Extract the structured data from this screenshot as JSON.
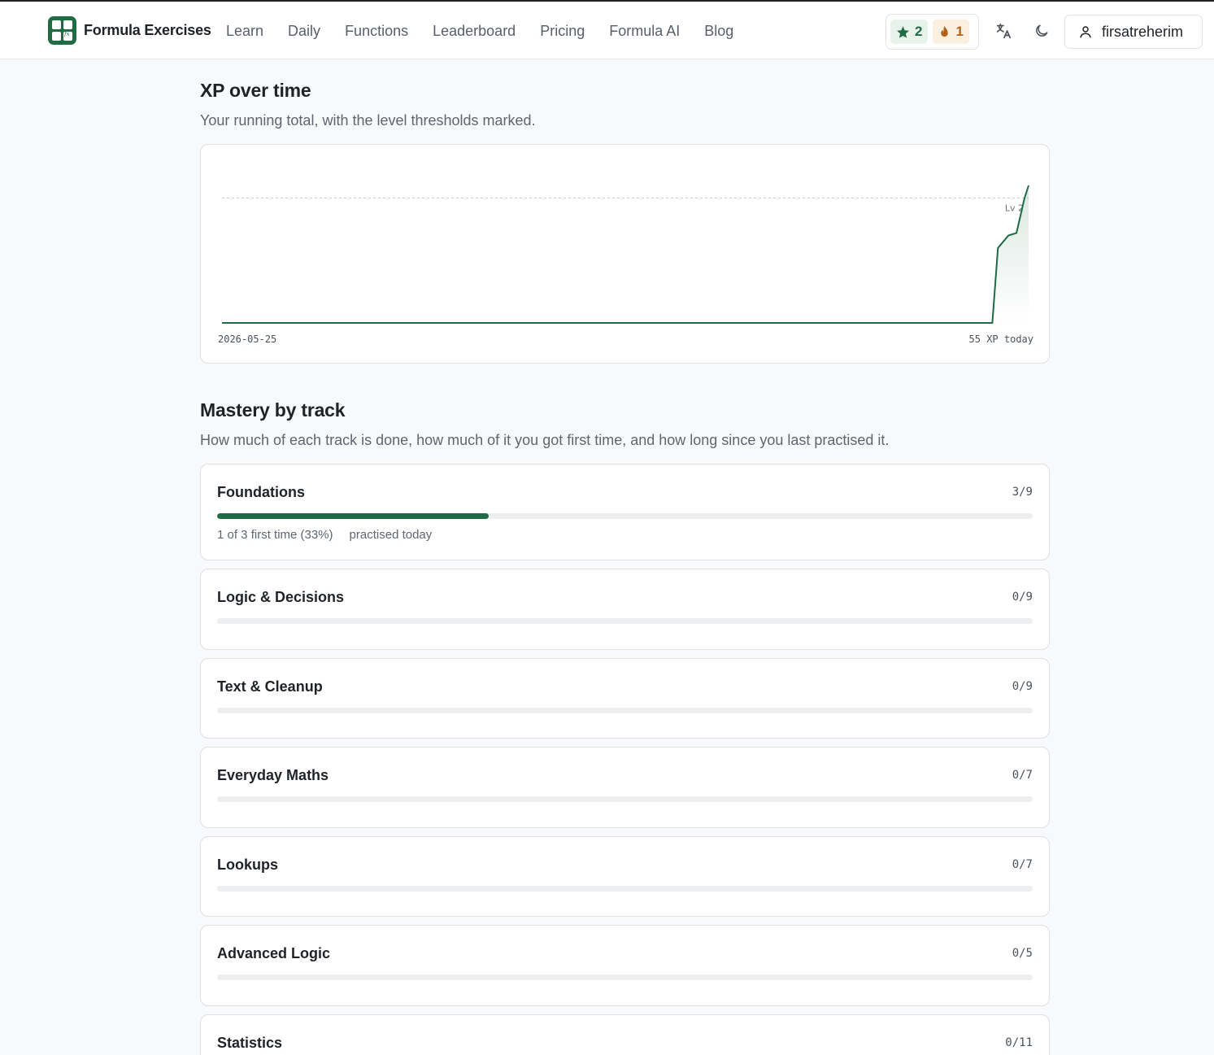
{
  "header": {
    "brand": "Formula Exercises",
    "nav": [
      "Learn",
      "Daily",
      "Functions",
      "Leaderboard",
      "Pricing",
      "Formula AI",
      "Blog"
    ],
    "xp_count": "2",
    "streak_count": "1",
    "username": "firsatreherim"
  },
  "xp_section": {
    "title": "XP over time",
    "subtitle": "Your running total, with the level thresholds marked."
  },
  "chart_data": {
    "type": "area",
    "series": [
      {
        "x": [
          0,
          0.955,
          0.962,
          0.975,
          0.985,
          0.995,
          1.0
        ],
        "values": [
          0,
          0,
          30,
          35,
          36,
          50,
          55
        ]
      }
    ],
    "x_start_label": "2026-05-25",
    "x_end_label": "55 XP today",
    "thresholds": [
      {
        "label": "Lv 2",
        "value": 50
      }
    ],
    "ylim": [
      0,
      55
    ],
    "line_color": "#1f6b43",
    "grid": false
  },
  "mastery_section": {
    "title": "Mastery by track",
    "subtitle": "How much of each track is done, how much of it you got first time, and how long since you last practised it."
  },
  "tracks": [
    {
      "name": "Foundations",
      "count": "3/9",
      "progress": 0.333,
      "first_time": "1 of 3 first time (33%)",
      "last_practised": "practised today"
    },
    {
      "name": "Logic & Decisions",
      "count": "0/9",
      "progress": 0
    },
    {
      "name": "Text & Cleanup",
      "count": "0/9",
      "progress": 0
    },
    {
      "name": "Everyday Maths",
      "count": "0/7",
      "progress": 0
    },
    {
      "name": "Lookups",
      "count": "0/7",
      "progress": 0
    },
    {
      "name": "Advanced Logic",
      "count": "0/5",
      "progress": 0
    },
    {
      "name": "Statistics",
      "count": "0/11",
      "progress": 0
    }
  ],
  "colors": {
    "accent": "#1f6b43",
    "streak": "#b3621b"
  }
}
